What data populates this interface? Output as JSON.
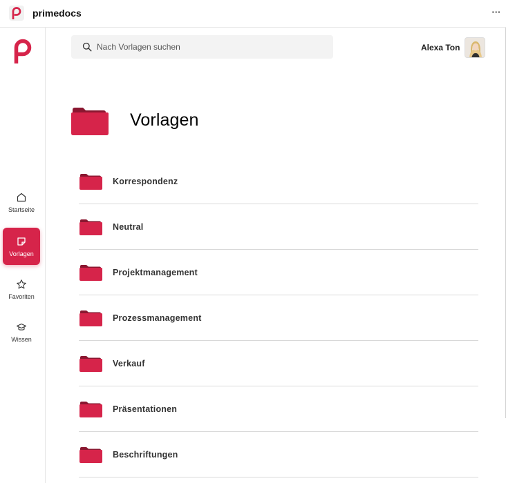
{
  "app": {
    "name": "primedocs"
  },
  "titlebar": {
    "more_label": "···"
  },
  "sidebar": {
    "items": [
      {
        "id": "home",
        "label": "Startseite",
        "icon": "home-icon",
        "active": false
      },
      {
        "id": "templates",
        "label": "Vorlagen",
        "icon": "sticky-note-icon",
        "active": true
      },
      {
        "id": "favorites",
        "label": "Favoriten",
        "icon": "star-icon",
        "active": false
      },
      {
        "id": "knowledge",
        "label": "Wissen",
        "icon": "graduation-cap-icon",
        "active": false
      }
    ]
  },
  "search": {
    "placeholder": "Nach Vorlagen suchen",
    "value": ""
  },
  "user": {
    "name": "Alexa Ton"
  },
  "page": {
    "title": "Vorlagen"
  },
  "folders": [
    {
      "label": "Korrespondenz"
    },
    {
      "label": "Neutral"
    },
    {
      "label": "Projektmanagement"
    },
    {
      "label": "Prozessmanagement"
    },
    {
      "label": "Verkauf"
    },
    {
      "label": "Präsentationen"
    },
    {
      "label": "Beschriftungen"
    }
  ],
  "colors": {
    "brand": "#d6244a",
    "folder_tab": "#8a1730",
    "folder_body": "#d6244a"
  }
}
